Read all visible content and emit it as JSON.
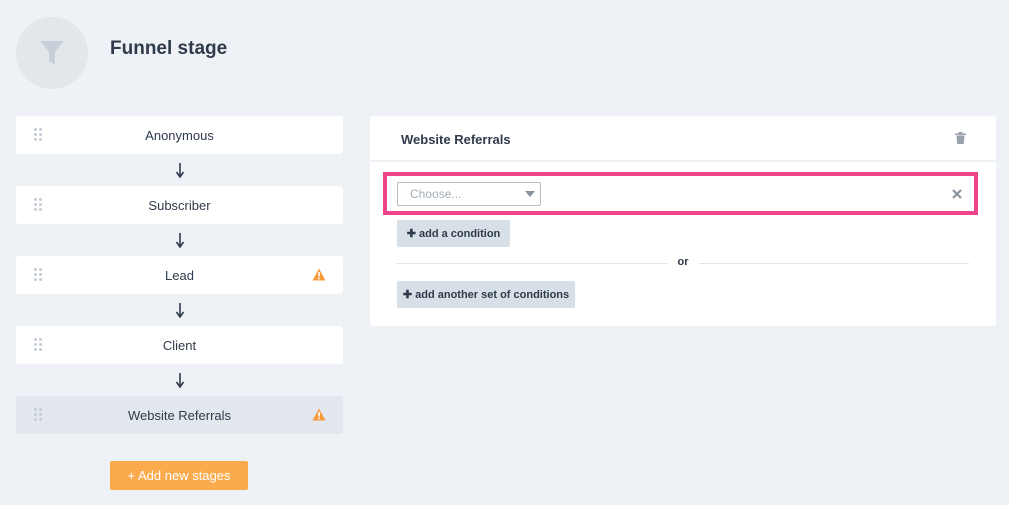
{
  "header": {
    "title": "Funnel stage",
    "icon": "funnel-icon"
  },
  "stages": [
    {
      "label": "Anonymous",
      "warning": false,
      "active": false
    },
    {
      "label": "Subscriber",
      "warning": false,
      "active": false
    },
    {
      "label": "Lead",
      "warning": true,
      "active": false
    },
    {
      "label": "Client",
      "warning": false,
      "active": false
    },
    {
      "label": "Website Referrals",
      "warning": true,
      "active": true
    }
  ],
  "add_stage_label": "+ Add new stages",
  "panel": {
    "title": "Website Referrals",
    "condition": {
      "placeholder": "Choose..."
    },
    "add_condition_label": "add a condition",
    "or_label": "or",
    "add_set_label": "add another set of conditions"
  },
  "colors": {
    "accent_orange": "#fbab4c",
    "highlight_pink": "#f0448a",
    "warning": "#f79a3e",
    "background": "#eef1f5"
  }
}
